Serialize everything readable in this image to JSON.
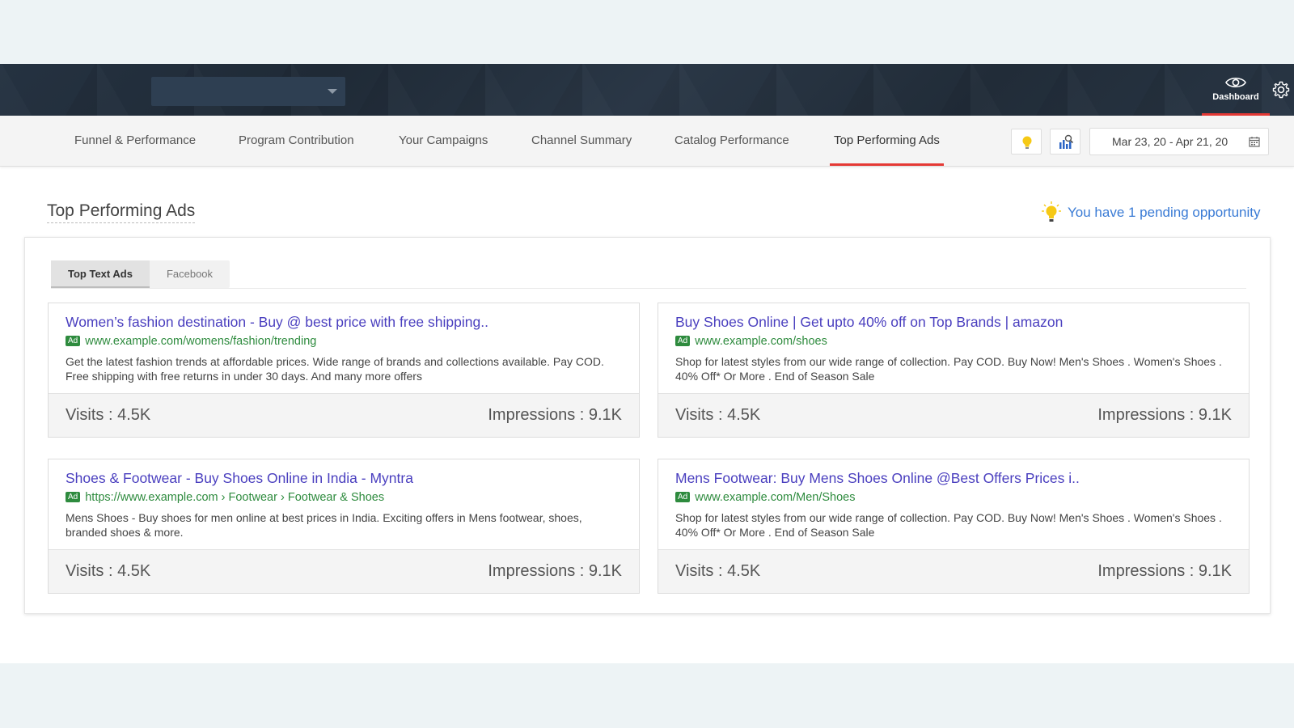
{
  "header": {
    "account_select_value": "",
    "dashboard_label": "Dashboard"
  },
  "nav": {
    "tabs": [
      {
        "label": "Funnel & Performance"
      },
      {
        "label": "Program Contribution"
      },
      {
        "label": "Your Campaigns"
      },
      {
        "label": "Channel Summary"
      },
      {
        "label": "Catalog Performance"
      },
      {
        "label": "Top Performing Ads",
        "active": true
      }
    ],
    "date_range": "Mar 23, 20 - Apr 21, 20"
  },
  "page": {
    "title": "Top Performing Ads",
    "opportunity_text": "You have 1 pending opportunity"
  },
  "subtabs": [
    "Top Text Ads",
    "Facebook"
  ],
  "ad_badge": "Ad",
  "ads": [
    {
      "title": "Women’s fashion destination - Buy @ best price with free shipping..",
      "url": "www.example.com/womens/fashion/trending",
      "description": "Get the latest fashion trends at affordable prices. Wide range of brands and collections available. Pay COD. Free shipping with free returns in under 30 days.  And many more offers",
      "visits": "Visits : 4.5K",
      "impressions": "Impressions : 9.1K"
    },
    {
      "title": "Buy Shoes Online | Get upto 40% off on Top Brands | amazon",
      "url": "www.example.com/shoes",
      "description": "Shop for latest styles from our wide range of collection. Pay COD. Buy Now! Men's Shoes . Women's Shoes . 40% Off* Or More . End of Season Sale",
      "visits": "Visits : 4.5K",
      "impressions": "Impressions : 9.1K"
    },
    {
      "title": "Shoes & Footwear - Buy Shoes Online in India - Myntra",
      "url": "https://www.example.com › Footwear › Footwear & Shoes",
      "description": "Mens Shoes - Buy shoes for men online at best prices in India. Exciting offers in Mens footwear, shoes, branded shoes & more.",
      "visits": "Visits : 4.5K",
      "impressions": "Impressions : 9.1K"
    },
    {
      "title": "Mens Footwear: Buy Mens Shoes Online @Best Offers Prices i..",
      "url": "www.example.com/Men/Shoes",
      "description": "Shop for latest styles from our wide range of collection. Pay COD. Buy Now! Men's Shoes . Women's Shoes . 40% Off* Or More . End of Season Sale",
      "visits": "Visits : 4.5K",
      "impressions": "Impressions : 9.1K"
    }
  ],
  "colors": {
    "accent_red": "#e53935",
    "link_purple": "#4a3fbf",
    "url_green": "#2e8b3e",
    "opportunity_blue": "#3a7bd5"
  },
  "icons": [
    "eye-icon",
    "gear-icon",
    "lightbulb-icon",
    "chart-search-icon",
    "calendar-icon",
    "chevron-down-icon"
  ]
}
